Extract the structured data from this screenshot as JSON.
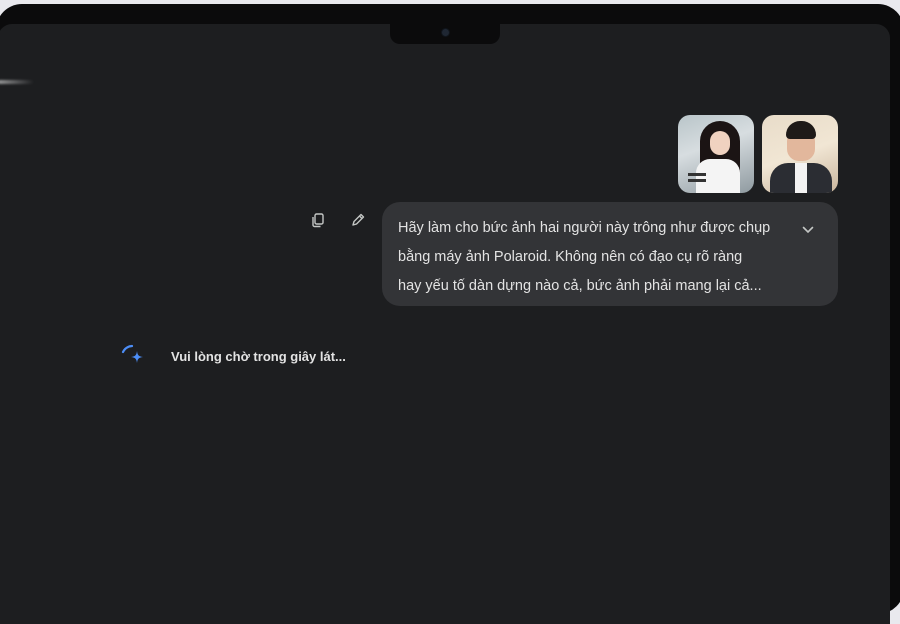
{
  "chat": {
    "user_message": {
      "attachments": [
        {
          "name": "woman-photo"
        },
        {
          "name": "man-photo"
        }
      ],
      "lines": [
        "Hãy làm cho bức ảnh hai người này trông như được chụp",
        "bằng máy ảnh Polaroid. Không nên có đạo cụ rõ ràng",
        "hay yếu tố dàn dựng nào cả, bức ảnh phải mang lại cả..."
      ]
    },
    "actions": {
      "copy_icon": "copy-icon",
      "edit_icon": "edit-icon",
      "expand_icon": "chevron-down-icon"
    },
    "status": {
      "text": "Vui lòng chờ trong giây lát...",
      "icon": "sparkle-spinner-icon"
    }
  },
  "colors": {
    "screen_bg": "#1d1e20",
    "bubble_bg": "#333437",
    "text": "#e3e3e3",
    "accent_blue": "#4c8df6"
  }
}
